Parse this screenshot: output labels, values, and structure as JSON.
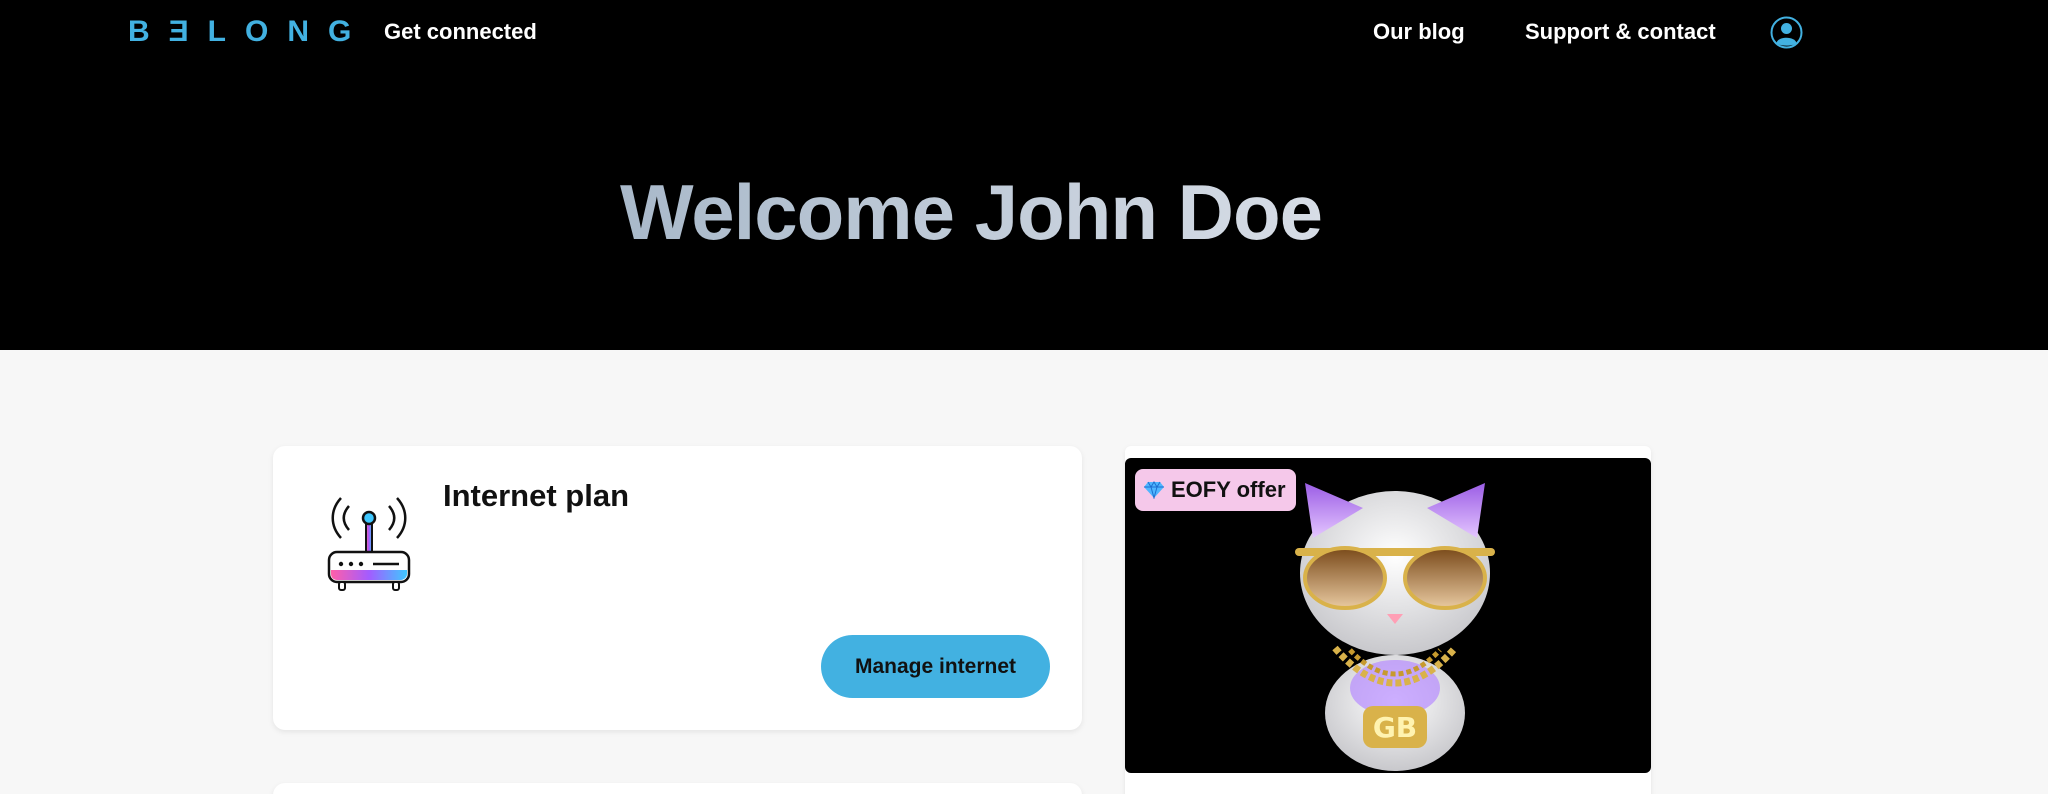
{
  "header": {
    "logo_text": "BƎLONG",
    "nav_left": "Get connected",
    "nav_blog": "Our blog",
    "nav_support": "Support & contact",
    "account_icon": "account-icon"
  },
  "hero": {
    "welcome": "Welcome John Doe"
  },
  "plan_card": {
    "title": "Internet plan",
    "icon": "router-icon",
    "button": "Manage internet"
  },
  "offer_card": {
    "badge": "EOFY offer",
    "badge_icon": "gem-icon",
    "image": "cat-with-gold-chain"
  },
  "colors": {
    "brand": "#42b1e1",
    "badge_bg": "#f5c8ea",
    "header_bg": "#000000",
    "page_bg": "#f7f7f7"
  }
}
